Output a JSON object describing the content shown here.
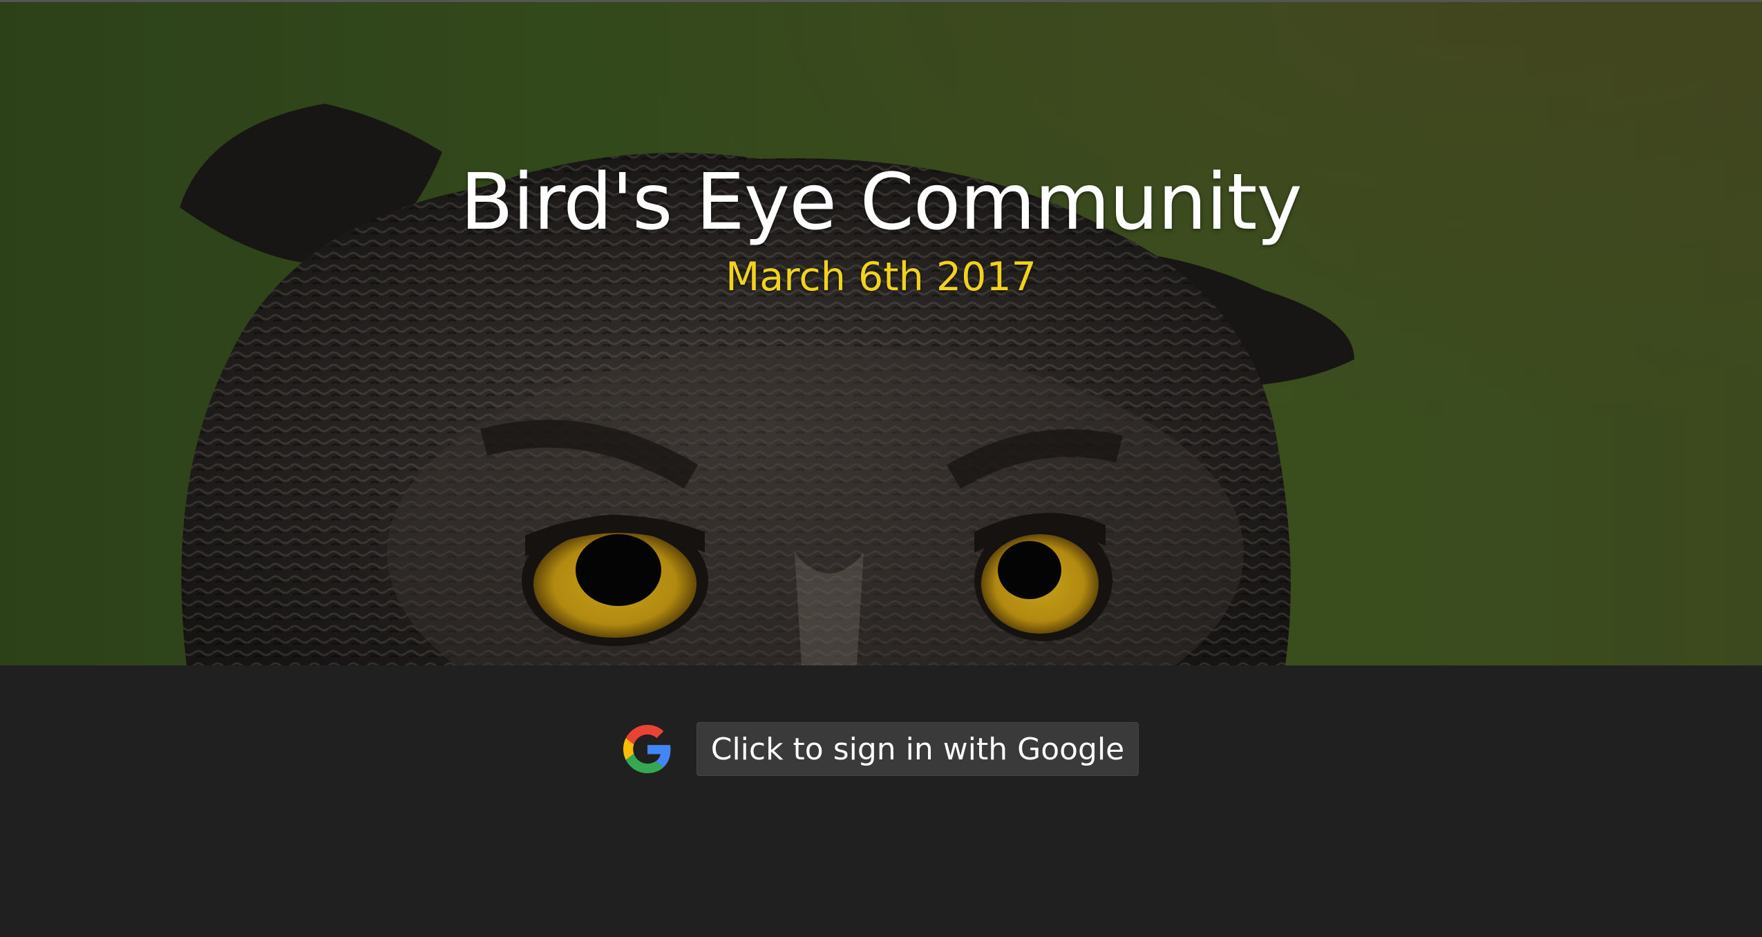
{
  "hero": {
    "title": "Bird's Eye Community",
    "date": "March 6th 2017",
    "background": "owl-photo",
    "title_color": "#ffffff",
    "date_color": "#f2d31b"
  },
  "signin": {
    "icon": "google-icon",
    "button_label": "Click to sign in with Google"
  },
  "colors": {
    "page_background": "#202020",
    "button_background": "#3a3a3a"
  }
}
